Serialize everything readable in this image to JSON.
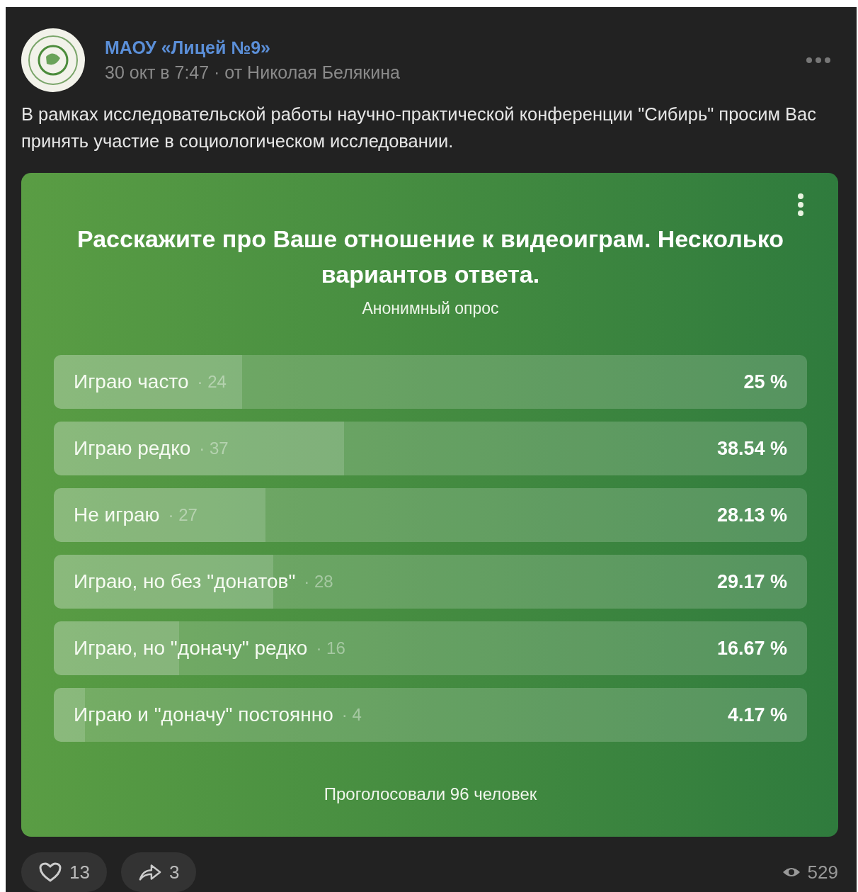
{
  "post": {
    "author": "МАОУ «Лицей №9»",
    "meta": "30 окт в 7:47 · от Николая Белякина",
    "text": "В рамках исследовательской работы научно-практической конференции \"Сибирь\" просим Вас принять участие в социологическом исследовании."
  },
  "poll": {
    "title": "Расскажите про Ваше отношение к видеоиграм. Несколько вариантов ответа.",
    "subtitle": "Анонимный опрос",
    "options": [
      {
        "label": "Играю часто",
        "count": "· 24",
        "percent": "25 %",
        "level": 0.25
      },
      {
        "label": "Играю редко",
        "count": "· 37",
        "percent": "38.54 %",
        "level": 0.3854
      },
      {
        "label": "Не играю",
        "count": "· 27",
        "percent": "28.13 %",
        "level": 0.2813
      },
      {
        "label": "Играю, но без \"донатов\"",
        "count": "· 28",
        "percent": "29.17 %",
        "level": 0.2917
      },
      {
        "label": "Играю, но \"доначу\" редко",
        "count": "· 16",
        "percent": "16.67 %",
        "level": 0.1667
      },
      {
        "label": "Играю и \"доначу\" постоянно",
        "count": "· 4",
        "percent": "4.17 %",
        "level": 0.0417
      }
    ],
    "footer": "Проголосовали 96 человек"
  },
  "actions": {
    "likes": "13",
    "shares": "3",
    "views": "529"
  }
}
